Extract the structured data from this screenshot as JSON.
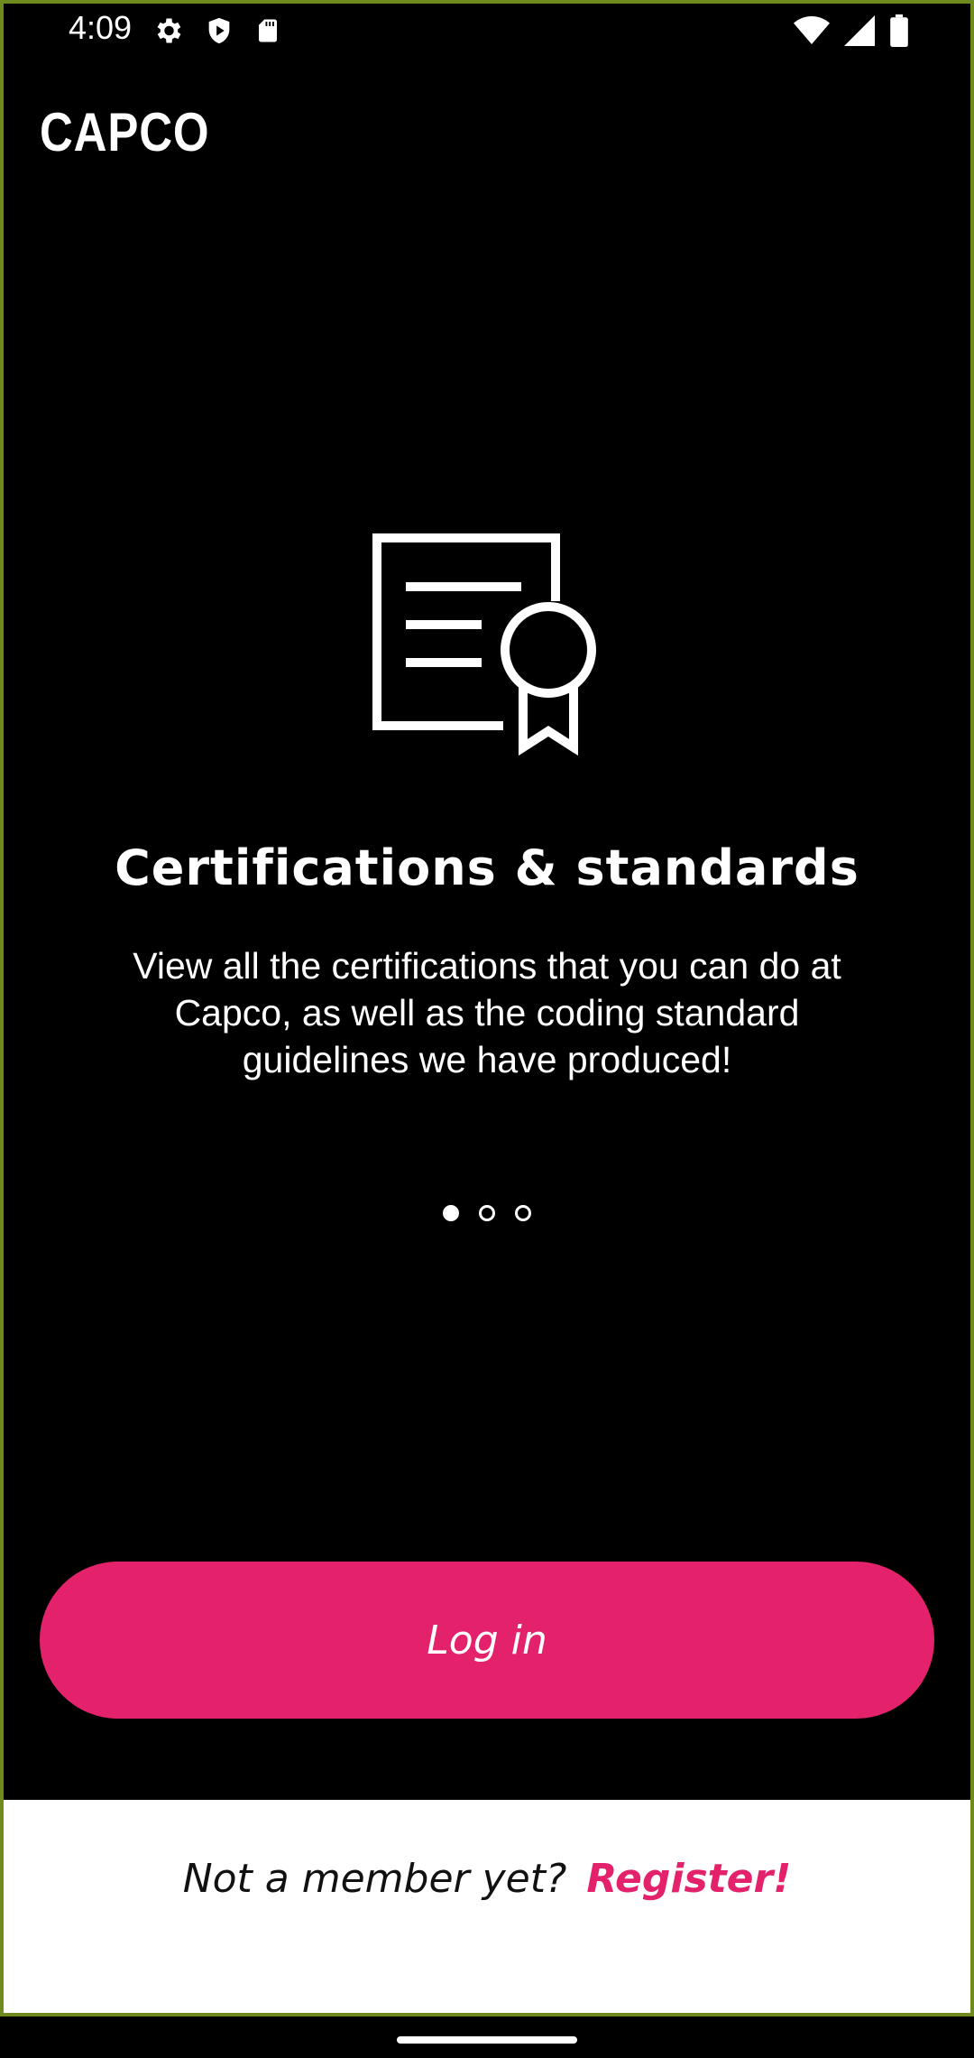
{
  "status_bar": {
    "time": "4:09",
    "left_icons": [
      "settings-icon",
      "shield-play-icon",
      "sd-card-icon"
    ],
    "right_icons": [
      "wifi-icon",
      "signal-icon",
      "battery-icon"
    ]
  },
  "header": {
    "logo_text": "CAPCO"
  },
  "onboarding": {
    "icon": "certificate-icon",
    "title": "Certifications & standards",
    "description": "View all the certifications that you can do at Capco, as well as the coding standard guidelines we have produced!",
    "pager": {
      "total": 3,
      "active_index": 0
    }
  },
  "actions": {
    "login_label": "Log in",
    "register_prompt": "Not a member yet?",
    "register_link": "Register!"
  },
  "colors": {
    "accent": "#e4226c",
    "background": "#000000",
    "panel": "#ffffff"
  }
}
